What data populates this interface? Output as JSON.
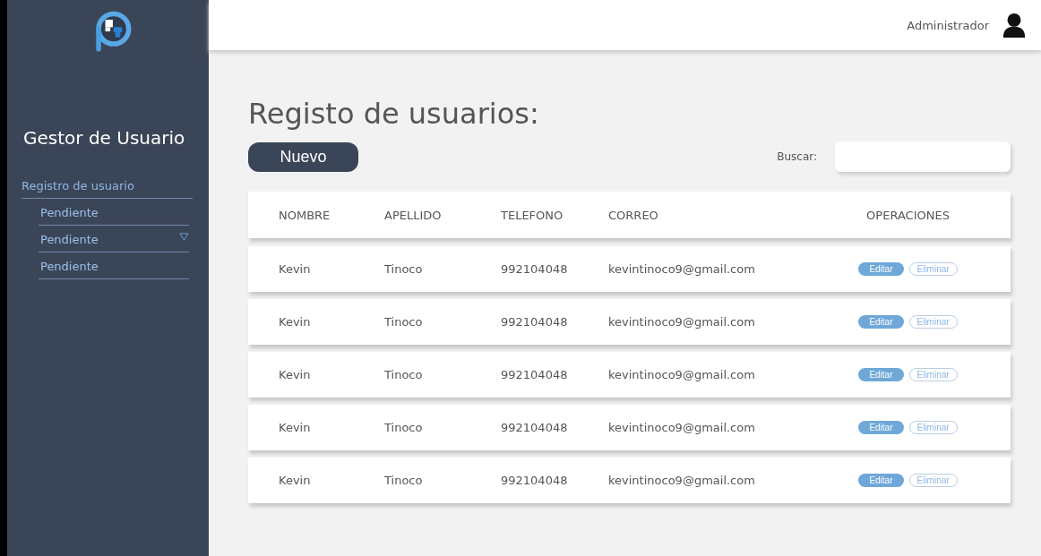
{
  "sidebar": {
    "title": "Gestor de Usuario",
    "items": [
      {
        "label": "Registro de usuario",
        "selected": true,
        "children": [
          {
            "label": "Pendiente",
            "selected": false
          },
          {
            "label": "Pendiente",
            "selected": false,
            "kind": "group"
          },
          {
            "label": "Pendiente",
            "selected": false
          }
        ]
      }
    ]
  },
  "header": {
    "user": "Administrador"
  },
  "page_title": "Registo de usuarios:",
  "new_button": "Nuevo",
  "search": {
    "label": "Buscar:"
  },
  "table": {
    "columns": [
      "NOMBRE",
      "APELLIDO",
      "TELEFONO",
      "CORREO",
      "OPERACIONES"
    ],
    "rows": [
      {
        "cells": [
          "Kevin",
          "Tinoco",
          "992104048",
          "kevintinoco9@gmail.com"
        ],
        "actions": [
          "Editar",
          "Eliminar"
        ]
      },
      {
        "cells": [
          "Kevin",
          "Tinoco",
          "992104048",
          "kevintinoco9@gmail.com"
        ],
        "actions": [
          "Editar",
          "Eliminar"
        ]
      },
      {
        "cells": [
          "Kevin",
          "Tinoco",
          "992104048",
          "kevintinoco9@gmail.com"
        ],
        "actions": [
          "Editar",
          "Eliminar"
        ]
      },
      {
        "cells": [
          "Kevin",
          "Tinoco",
          "992104048",
          "kevintinoco9@gmail.com"
        ],
        "actions": [
          "Editar",
          "Eliminar"
        ]
      },
      {
        "cells": [
          "Kevin",
          "Tinoco",
          "992104048",
          "kevintinoco9@gmail.com"
        ],
        "actions": [
          "Editar",
          "Eliminar"
        ]
      }
    ]
  }
}
